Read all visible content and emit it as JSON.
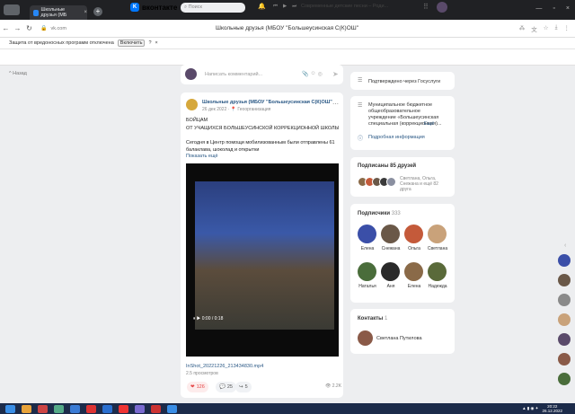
{
  "browser": {
    "tab_title": "Школьные друзья (МБ",
    "tab_close": "×",
    "new_tab": "+",
    "window_controls": [
      "—",
      "▫",
      "×"
    ],
    "url": "vk.com",
    "page_title": "Школьные друзья (МБОУ \"Большеусинская С(К)ОШ\"",
    "notice_text": "Защита от вредоносных программ отключена",
    "notice_button": "Включить",
    "notice_help": "?",
    "notice_close": "×"
  },
  "vk": {
    "logo_text": "вконтакте",
    "logo_mark": "K",
    "search_placeholder": "Поиск",
    "player_controls": [
      "⏮",
      "▶",
      "⏭"
    ],
    "now_playing": "Современные детские песни – Роди..."
  },
  "back_label": "^ Назад",
  "composer": {
    "placeholder": "Написать комментарий..."
  },
  "post": {
    "author": "Школьные друзья (МБОУ \"Большеусинская С(К)ОШ\"",
    "date": "26 дек 2022 · 📍 Геоорганизация",
    "line1": "БОЙЦАМ",
    "line2": "ОТ УЧАЩИХСЯ БОЛЬШЕУСИНСКОЙ КОРРЕКЦИОННОЙ ШКОЛЫ",
    "line3": "Сегодня в Центр помощи мобилизованным были отправлены 61 балаклава, шоколад и открытки",
    "show_more": "Показать ещё",
    "video_overlay": "⏸ ▶ 0:00 / 0:18",
    "video_file": "InShot_20221226_213434830.mp4",
    "video_views": "2.5 просмотров",
    "likes": "126",
    "comments": "25",
    "reposts": "5",
    "views": "2.2K"
  },
  "right": {
    "gosus": "Подтверждено через Госуслуги",
    "info_text": "Муниципальное бюджетное общеобразовательное учреждение «Большеусинская специальная (коррекционная)...",
    "info_more": "Ещё",
    "info_link": "Подробная информация",
    "friends_header": "Подписаны 85 друзей",
    "friends_names": "Светлана, Ольга, Снежана и ещё 82 друга",
    "subs_header": "Подписчики",
    "subs_count": "333",
    "subscribers": [
      {
        "name": "Елена",
        "color": "#3b4fa8"
      },
      {
        "name": "Снежана",
        "color": "#6a5848"
      },
      {
        "name": "Ольга",
        "color": "#c45a3a"
      },
      {
        "name": "Светлана",
        "color": "#c9a27a"
      },
      {
        "name": "Наталья",
        "color": "#4a6d3b"
      },
      {
        "name": "Аня",
        "color": "#2a2a2a"
      },
      {
        "name": "Елена",
        "color": "#8a6a48"
      },
      {
        "name": "Надежда",
        "color": "#5a6a3a"
      }
    ],
    "contacts_header": "Контакты",
    "contacts_count": "1",
    "contact_name": "Светлана Путилова"
  },
  "taskbar": {
    "time": "20:22",
    "date": "26.12.2022"
  }
}
